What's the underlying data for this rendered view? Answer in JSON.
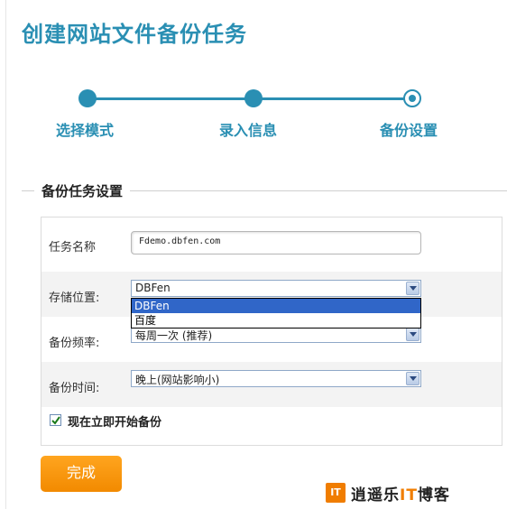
{
  "page": {
    "title": "创建网站文件备份任务"
  },
  "stepper": {
    "steps": [
      {
        "label": "选择模式"
      },
      {
        "label": "录入信息"
      },
      {
        "label": "备份设置"
      }
    ],
    "current_step": 3
  },
  "section": {
    "title": "备份任务设置"
  },
  "form": {
    "task_name": {
      "label": "任务名称",
      "value": "Fdemo.dbfen.com"
    },
    "storage": {
      "label": "存储位置:",
      "value": "DBFen",
      "options": [
        "DBFen",
        "百度"
      ],
      "open": true
    },
    "frequency": {
      "label": "备份频率:",
      "value": "每周一次 (推荐)"
    },
    "time": {
      "label": "备份时间:",
      "value": "晚上(网站影响小)"
    },
    "start_now": {
      "label": "现在立即开始备份",
      "checked": true
    }
  },
  "actions": {
    "finish_label": "完成"
  },
  "watermark": {
    "mark": "IT",
    "text_prefix": "逍遥乐",
    "text_it": "IT",
    "text_suffix": "博客"
  },
  "colors": {
    "accent": "#2a8fb3",
    "button": "#f28a00",
    "dropdown_highlight": "#3066c8"
  }
}
